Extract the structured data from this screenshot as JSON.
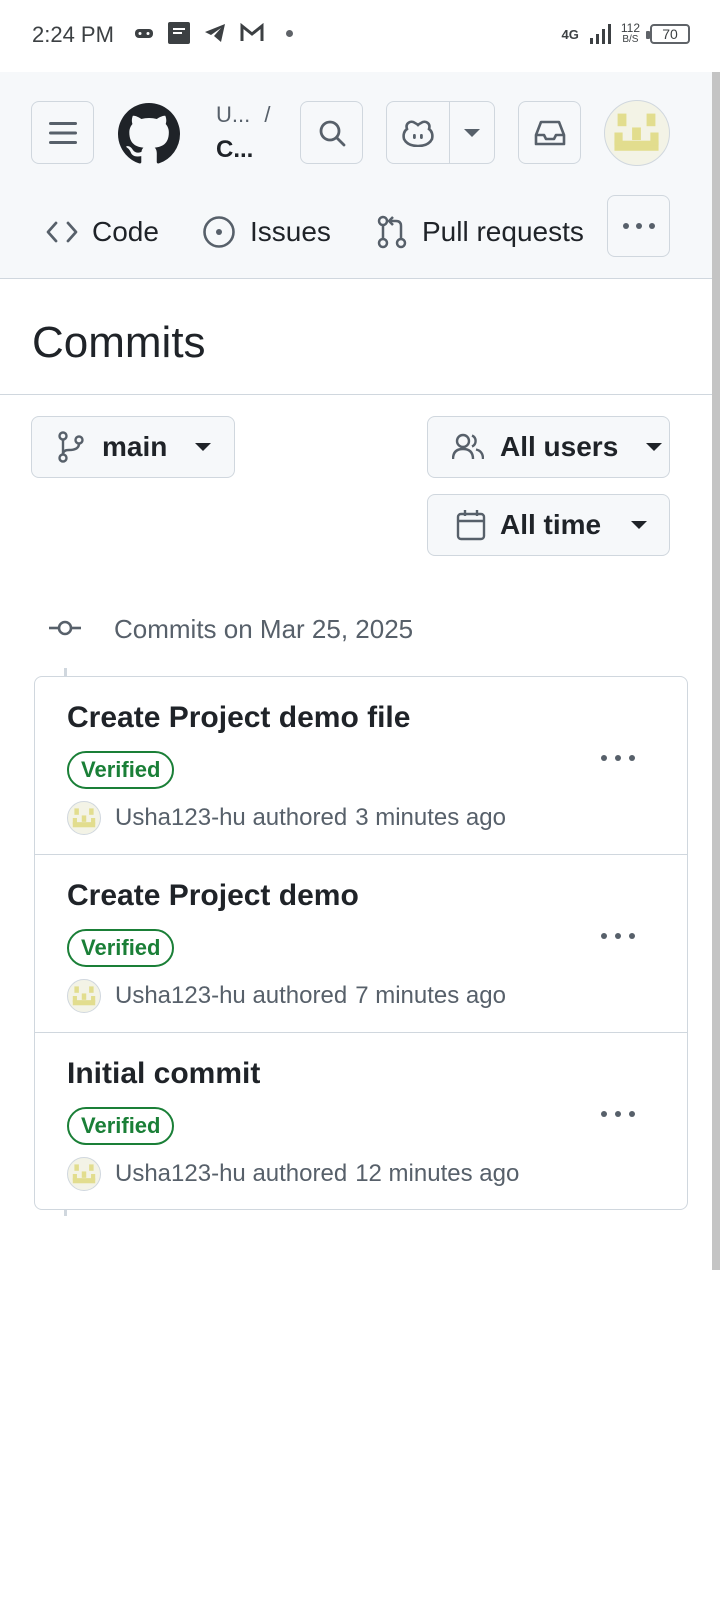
{
  "status_bar": {
    "time": "2:24 PM",
    "network": "4G",
    "speed_value": "112",
    "speed_unit": "B/S",
    "battery": "70"
  },
  "header": {
    "owner": "U...",
    "separator": "/",
    "repo": "C...",
    "icons": [
      "menu-icon",
      "github-logo",
      "search-icon",
      "copilot-icon",
      "chevron-down-icon",
      "inbox-icon",
      "avatar"
    ]
  },
  "repo_nav": {
    "tabs": [
      {
        "label": "Code",
        "icon": "code-icon"
      },
      {
        "label": "Issues",
        "icon": "issue-icon"
      },
      {
        "label": "Pull requests",
        "icon": "pull-request-icon"
      }
    ]
  },
  "page": {
    "title": "Commits"
  },
  "filters": {
    "branch": "main",
    "users": "All users",
    "time": "All time"
  },
  "commit_group": {
    "heading": "Commits on Mar 25, 2025"
  },
  "commits": [
    {
      "title": "Create Project demo file",
      "badge": "Verified",
      "author": "Usha123-hu",
      "verb": "authored",
      "time": "3 minutes ago"
    },
    {
      "title": "Create Project demo",
      "badge": "Verified",
      "author": "Usha123-hu",
      "verb": "authored",
      "time": "7 minutes ago"
    },
    {
      "title": "Initial commit",
      "badge": "Verified",
      "author": "Usha123-hu",
      "verb": "authored",
      "time": "12 minutes ago"
    }
  ],
  "colors": {
    "header_bg": "#f6f8fa",
    "border": "#d0d7de",
    "verified_green": "#1a7f37",
    "avatar_yellow": "#e2dd8e"
  }
}
